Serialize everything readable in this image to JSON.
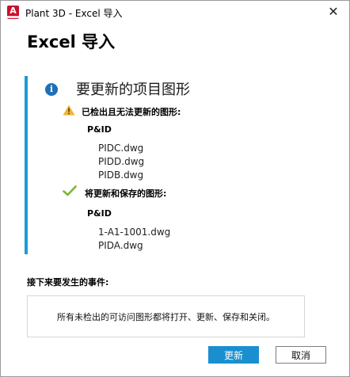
{
  "window": {
    "title": "Plant 3D - Excel 导入",
    "app_icon_letter": "A",
    "close_glyph": "✕"
  },
  "heading": "Excel 导入",
  "panel": {
    "title": "要更新的项目图形",
    "info_glyph": "i",
    "accent_color": "#1a9bd7",
    "sections": [
      {
        "icon": "warning-icon",
        "label": "已检出且无法更新的图形:",
        "group": "P&ID",
        "files": [
          "PIDC.dwg",
          "PIDD.dwg",
          "PIDB.dwg"
        ]
      },
      {
        "icon": "check-icon",
        "label": "将更新和保存的图形:",
        "group": "P&ID",
        "files": [
          "1-A1-1001.dwg",
          "PIDA.dwg"
        ]
      }
    ]
  },
  "next": {
    "label": "接下来要发生的事件:",
    "description": "所有未检出的可访问图形都将打开、更新、保存和关闭。"
  },
  "buttons": {
    "primary": "更新",
    "secondary": "取消"
  }
}
